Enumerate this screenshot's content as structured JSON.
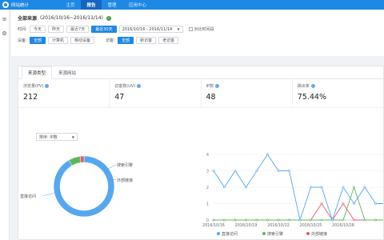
{
  "app": {
    "title": "网站统计"
  },
  "nav": [
    "主页",
    "报告",
    "管理",
    "应用中心"
  ],
  "nav_active": 1,
  "sidebar": {
    "icons": [
      "menu-icon",
      "gear-icon"
    ]
  },
  "crumb": {
    "title": "全部来源",
    "range": "(2016/10/16~2016/11/14)"
  },
  "filters": {
    "time_label": "时间:",
    "time_buttons": [
      "今天",
      "昨天",
      "最近7天",
      "最近30天"
    ],
    "time_selected": 3,
    "date_value": "2016/10/16 - 2016/11/14",
    "compare_label": "对比时间段",
    "device_label": "设备:",
    "device_buttons": [
      "全部",
      "计算机",
      "移动设备"
    ],
    "device_selected": 0,
    "visitor_label": "访客:",
    "visitor_buttons": [
      "全部",
      "新访客",
      "老访客"
    ],
    "visitor_selected": 0
  },
  "tabs": [
    "来源类型",
    "来源网站"
  ],
  "tab_active": 0,
  "metrics": [
    {
      "label": "浏览量(PV)",
      "value": "212"
    },
    {
      "label": "访客数(UV)",
      "value": "47"
    },
    {
      "label": "IP数",
      "value": "48"
    },
    {
      "label": "跳出率",
      "value": "75.44%"
    }
  ],
  "sort": {
    "label": "排序: IP数"
  },
  "colors": {
    "direct": "#55a8f0",
    "search": "#5cb85c",
    "external": "#e35d6a",
    "primary": "#1e88e5"
  },
  "chart_data": [
    {
      "type": "pie",
      "labels": [
        "直接访问",
        "搜索引擎",
        "外部链接"
      ],
      "values": [
        44,
        3,
        1
      ]
    },
    {
      "type": "line",
      "x": [
        "2016/10/16",
        "2016/10/17",
        "2016/10/18",
        "2016/10/19",
        "2016/10/20",
        "2016/10/21",
        "2016/10/22",
        "2016/10/23",
        "2016/10/24",
        "2016/10/25",
        "2016/10/26",
        "2016/10/27",
        "2016/10/28",
        "2016/10/29",
        "2016/10/30",
        "2016/10/31",
        "2016/11/01"
      ],
      "tick_labels": [
        "2016/10/16",
        "2016/10/19",
        "2016/10/22",
        "2016/10/25",
        "2016/10/28"
      ],
      "ylim": [
        0,
        4
      ],
      "yticks": [
        0,
        1,
        2,
        3,
        4
      ],
      "series": [
        {
          "name": "直接访问",
          "values": [
            3,
            2,
            3,
            2,
            3,
            4,
            3,
            3,
            0,
            2,
            2,
            0,
            2,
            1,
            2,
            1,
            1
          ]
        },
        {
          "name": "搜索引擎",
          "values": [
            0,
            0,
            0,
            0,
            0,
            0,
            0,
            0,
            0,
            0,
            0,
            0,
            0,
            2,
            0,
            0,
            0
          ]
        },
        {
          "name": "外部链接",
          "values": [
            0,
            0,
            0,
            0,
            0,
            0,
            0,
            0,
            0,
            0,
            1,
            0,
            1,
            0,
            0,
            0,
            0
          ]
        }
      ]
    }
  ]
}
